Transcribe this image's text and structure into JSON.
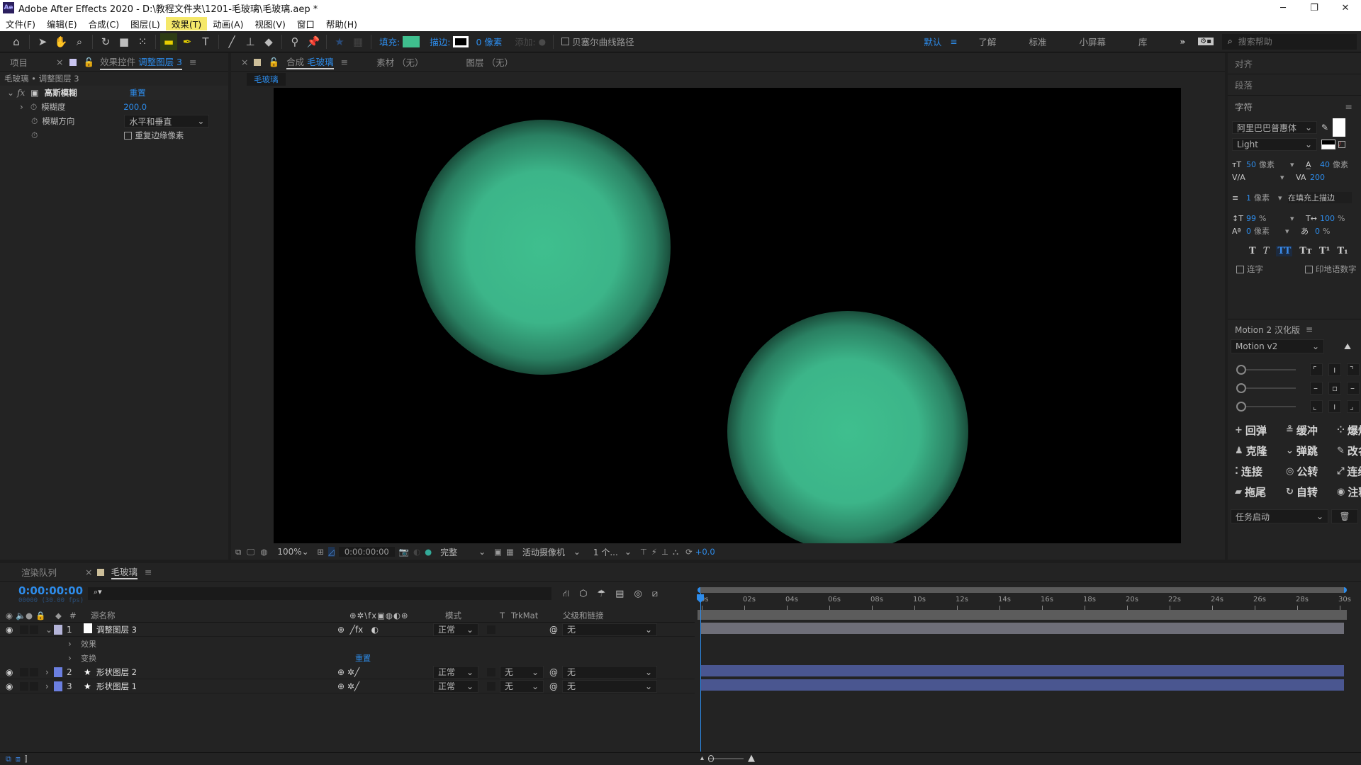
{
  "window": {
    "app_icon": "Ae",
    "title": "Adobe After Effects 2020 - D:\\教程文件夹\\1201-毛玻璃\\毛玻璃.aep *",
    "controls": [
      "─",
      "❐",
      "✕"
    ]
  },
  "menu": [
    "文件(F)",
    "编辑(E)",
    "合成(C)",
    "图层(L)",
    "效果(T)",
    "动画(A)",
    "视图(V)",
    "窗口",
    "帮助(H)"
  ],
  "toolbar": {
    "fill_label": "填充:",
    "fill_color": "#3fbf8e",
    "stroke_label": "描边:",
    "stroke_width": "0 像素",
    "add_label": "添加:",
    "bezier_label": "贝塞尔曲线路径",
    "workspaces": [
      "默认",
      "了解",
      "标准",
      "小屏幕",
      "库"
    ],
    "active_workspace": "默认",
    "more": "»",
    "search_placeholder": "搜索帮助"
  },
  "left_panel": {
    "tab_project": "项目",
    "tab_effects": "效果控件",
    "tab_effects_layer": "调整图层 3",
    "breadcrumb": "毛玻璃 • 调整图层 3",
    "effect": {
      "name": "高斯模糊",
      "reset": "重置",
      "properties": [
        {
          "label": "模糊度",
          "value": "200.0"
        },
        {
          "label": "模糊方向",
          "value": "水平和垂直"
        },
        {
          "label": "",
          "value": "重复边缘像素"
        }
      ]
    }
  },
  "viewer": {
    "tab_comp_prefix": "合成",
    "tab_comp_name": "毛玻璃",
    "tab_footage": "素材 （无）",
    "tab_layer": "图层 （无）",
    "comp_chip": "毛玻璃",
    "circle_color": "#3fbf8e",
    "footer": {
      "zoom": "100%",
      "timecode": "0:00:00:00",
      "resolution": "完整",
      "camera": "活动摄像机",
      "views": "1 个...",
      "exposure": "+0.0"
    }
  },
  "right_panel": {
    "align": "对齐",
    "paragraph": "段落",
    "character": "字符",
    "font_family": "阿里巴巴普惠体",
    "font_style": "Light",
    "font_size": "50",
    "leading": "40",
    "unit_px": "像素",
    "kerning": "",
    "tracking": "200",
    "stroke_width": "1",
    "stroke_mode": "在填充上描边",
    "vscale": "99",
    "hscale": "100",
    "baseline": "0",
    "tsume": "0",
    "percent": "%",
    "style_buttons": [
      "T",
      "T",
      "TT",
      "Tт",
      "T¹",
      "T₁"
    ],
    "ligatures": "连字",
    "hindi_digits": "印地语数字"
  },
  "motion_panel": {
    "title": "Motion 2 汉化版",
    "preset": "Motion v2",
    "buttons": [
      {
        "icon": "+",
        "label": "回弹"
      },
      {
        "icon": "≗",
        "label": "缓冲"
      },
      {
        "icon": "⁘",
        "label": "爆炸"
      },
      {
        "icon": "♟",
        "label": "克隆"
      },
      {
        "icon": "⌄",
        "label": "弹跳"
      },
      {
        "icon": "✎",
        "label": "改名"
      },
      {
        "icon": "⁚",
        "label": "连接"
      },
      {
        "icon": "◎",
        "label": "公转"
      },
      {
        "icon": "⤢",
        "label": "连线"
      },
      {
        "icon": "▰",
        "label": "拖尾"
      },
      {
        "icon": "↻",
        "label": "自转"
      },
      {
        "icon": "◉",
        "label": "注释"
      }
    ],
    "task": "任务启动"
  },
  "timeline": {
    "tab_render": "渲染队列",
    "tab_comp": "毛玻璃",
    "timecode": "0:00:00:00",
    "frame_info": "00000 (30.00 fps)",
    "columns": {
      "name": "源名称",
      "num": "#",
      "mode": "模式",
      "t": "T",
      "trkmat": "TrkMat",
      "parent": "父级和链接"
    },
    "ruler": [
      "0s",
      "02s",
      "04s",
      "06s",
      "08s",
      "10s",
      "12s",
      "14s",
      "16s",
      "18s",
      "20s",
      "22s",
      "24s",
      "26s",
      "28s",
      "30s"
    ],
    "layers": [
      {
        "num": "1",
        "name": "调整图层 3",
        "label_color": "#b4b4d8",
        "mode": "正常",
        "trkmat": "",
        "parent": "无",
        "switches": "fx"
      },
      {
        "num": "2",
        "name": "形状图层 2",
        "label_color": "#6b7fe0",
        "mode": "正常",
        "trkmat": "无",
        "parent": "无",
        "switches": ""
      },
      {
        "num": "3",
        "name": "形状图层 1",
        "label_color": "#6b7fe0",
        "mode": "正常",
        "trkmat": "无",
        "parent": "无",
        "switches": ""
      }
    ],
    "sub_effects": "效果",
    "sub_transform": "变换",
    "sub_reset": "重置"
  }
}
